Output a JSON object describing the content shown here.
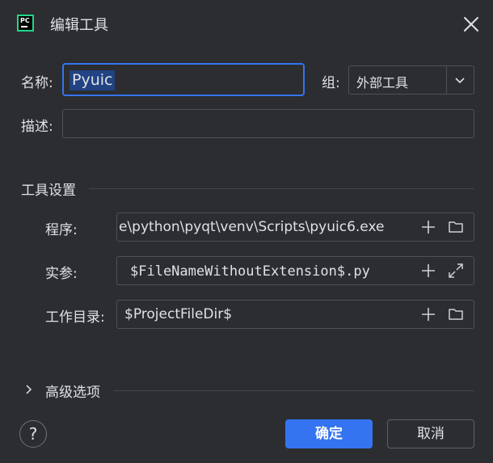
{
  "window": {
    "title": "编辑工具",
    "app_icon_text": "PC"
  },
  "form": {
    "name_label": "名称:",
    "name_value": "Pyuic",
    "group_label": "组:",
    "group_value": "外部工具",
    "description_label": "描述:",
    "description_value": ""
  },
  "tool_settings": {
    "section_title": "工具设置",
    "program_label": "程序:",
    "program_value": "e\\python\\pyqt\\venv\\Scripts\\pyuic6.exe",
    "arguments_label": "实参:",
    "arguments_value": "$FileNameWithoutExtension$.py",
    "working_dir_label": "工作目录:",
    "working_dir_value": "$ProjectFileDir$"
  },
  "advanced": {
    "label": "高级选项"
  },
  "footer": {
    "help_label": "?",
    "ok_label": "确定",
    "cancel_label": "取消"
  },
  "colors": {
    "background": "#2b2d30",
    "accent": "#3574f0",
    "selection": "#214283",
    "border": "#4e5157"
  }
}
